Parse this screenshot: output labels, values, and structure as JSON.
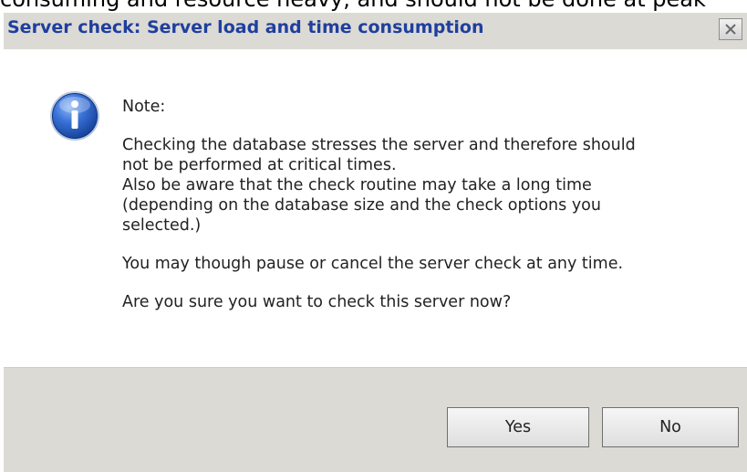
{
  "background": {
    "text": "consuming and resource heavy, and should not be done at peak"
  },
  "dialog": {
    "title": "Server check: Server load and time consumption",
    "title_color": "#1f3f9e",
    "close_icon": "close-icon",
    "info_icon": "info-icon",
    "note_heading": "Note:",
    "paragraph_1": [
      "Checking the database stresses the server and therefore should",
      "not be performed at critical times.",
      "Also be aware that the check routine may take a long time",
      "(depending on the database size and the check options you",
      "selected.)"
    ],
    "paragraph_2": "You may though pause or cancel the server check at any time.",
    "paragraph_3": "Are you sure you want to check this server now?",
    "buttons": {
      "yes": "Yes",
      "no": "No"
    }
  }
}
